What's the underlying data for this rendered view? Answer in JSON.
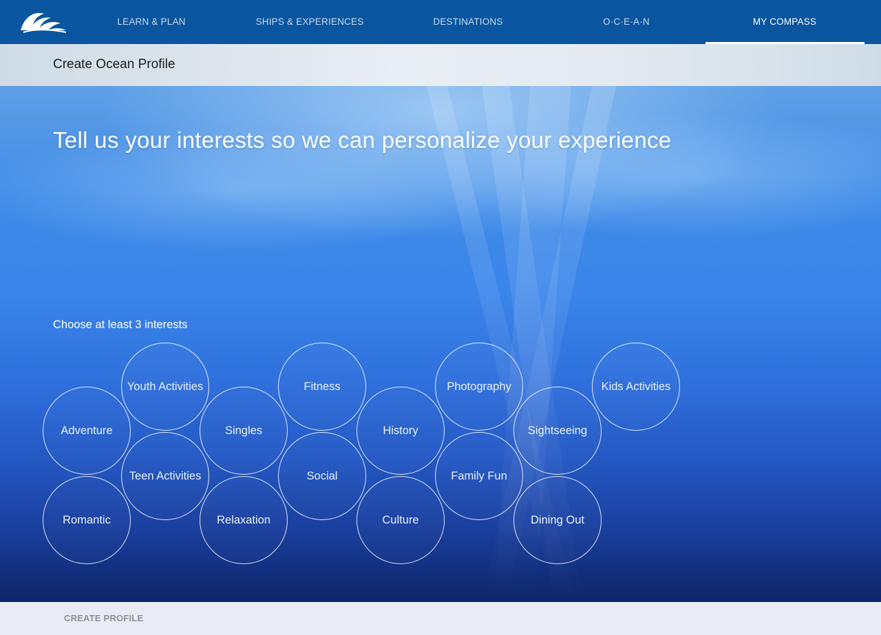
{
  "nav": {
    "logo": "princess-wave-logo",
    "items": [
      {
        "label": "LEARN & PLAN"
      },
      {
        "label": "SHIPS & EXPERIENCES"
      },
      {
        "label": "DESTINATIONS"
      },
      {
        "label": "O·C·E·A·N"
      },
      {
        "label": "MY COMPASS"
      }
    ],
    "active_index": 4
  },
  "subheader": {
    "title": "Create Ocean Profile"
  },
  "hero": {
    "headline": "Tell us your interests so we can personalize your experience",
    "instruction": "Choose at least 3 interests"
  },
  "interests": [
    {
      "label": "Youth Activities"
    },
    {
      "label": "Fitness"
    },
    {
      "label": "Photography"
    },
    {
      "label": "Kids Activities"
    },
    {
      "label": "Adventure"
    },
    {
      "label": "Singles"
    },
    {
      "label": "History"
    },
    {
      "label": "Sightseeing"
    },
    {
      "label": "Teen Activities"
    },
    {
      "label": "Social"
    },
    {
      "label": "Family Fun"
    },
    {
      "label": "Romantic"
    },
    {
      "label": "Relaxation"
    },
    {
      "label": "Culture"
    },
    {
      "label": "Dining Out"
    }
  ],
  "footer": {
    "create_label": "CREATE PROFILE"
  },
  "colors": {
    "nav_bg": "#0a559f",
    "nav_text": "#c9dbef",
    "footer_bg": "#e9ecf3"
  }
}
